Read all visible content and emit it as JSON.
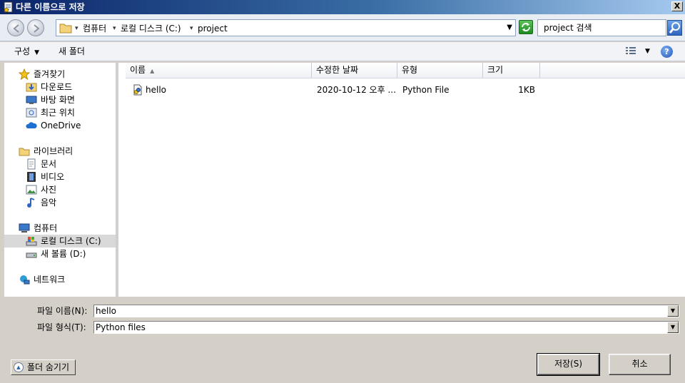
{
  "window": {
    "title": "다른 이름으로 저장",
    "close_label": "X"
  },
  "address": {
    "crumbs": [
      "컴퓨터",
      "로컬 디스크 (C:)",
      "project"
    ],
    "search_placeholder": "project 검색"
  },
  "toolbar": {
    "organize": "구성",
    "new_folder": "새 폴더",
    "help": "?"
  },
  "nav": {
    "favorites": {
      "label": "즐겨찾기",
      "items": [
        "다운로드",
        "바탕 화면",
        "최근 위치",
        "OneDrive"
      ]
    },
    "libraries": {
      "label": "라이브러리",
      "items": [
        "문서",
        "비디오",
        "사진",
        "음악"
      ]
    },
    "computer": {
      "label": "컴퓨터",
      "items": [
        "로컬 디스크 (C:)",
        "새 볼륨 (D:)"
      ]
    },
    "network": {
      "label": "네트워크"
    }
  },
  "columns": [
    "이름",
    "수정한 날짜",
    "유형",
    "크기"
  ],
  "files": [
    {
      "name": "hello",
      "modified": "2020-10-12 오후 ...",
      "type": "Python File",
      "size": "1KB"
    }
  ],
  "form": {
    "filename_label": "파일 이름(N):",
    "filename_value": "hello",
    "filetype_label": "파일 형식(T):",
    "filetype_value": "Python files"
  },
  "buttons": {
    "hide_folders": "폴더 숨기기",
    "save": "저장(S)",
    "cancel": "취소"
  },
  "colors": {
    "title_start": "#0a246a",
    "title_end": "#a6caf0",
    "dialog_bg": "#d4d0c8",
    "selection": "#d9d9d9"
  }
}
